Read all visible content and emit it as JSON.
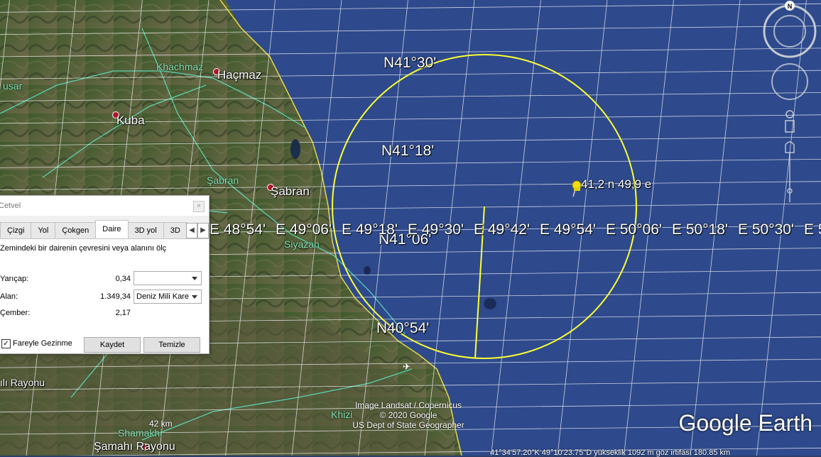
{
  "map": {
    "lat_labels": [
      "N41°30'",
      "N41°18'",
      "N41°06'",
      "N40°54'"
    ],
    "lon_labels": [
      "E 48°54'",
      "E 49°06'",
      "E 49°18'",
      "E 49°30'",
      "E 49°42'",
      "E 49°54'",
      "E 50°06'",
      "E 50°18'",
      "E 50°30'",
      "E 5"
    ],
    "places": {
      "khachmaz": "Khachmaz",
      "hacmaz": "Haçmaz",
      "kusar": "usar",
      "kuba": "Kuba",
      "sabran_green": "Şabran",
      "sabran": "Şabran",
      "siyazan": "Siyazan",
      "rayonu": "ılı Rayonu",
      "khizi": "Khizi",
      "shamakhi": "Shamakhi",
      "samahi_rayonu": "Şamahı Rayonu"
    },
    "pin_label": "41,2 n 49,9 e",
    "scale_text": "42 km",
    "attribution": [
      "Image Landsat / Copernicus",
      "© 2020 Google",
      "US Dept of State Geographer"
    ],
    "logo": "Google Earth",
    "status_bar": "41°34'57.20\"K    49°10'23.75\"D    yükseklik   1092 m        göz irtifası  180.85 km",
    "compass_label": "N",
    "colors": {
      "water": "#2e4a8c",
      "circle": "#ffff33",
      "grid": "#ffffff",
      "road": "#5ee6c4",
      "border": "#e6d84a"
    }
  },
  "ruler": {
    "title": "Cetvel",
    "tabs": [
      "Çizgi",
      "Yol",
      "Çokgen",
      "Daire",
      "3D yol",
      "3D"
    ],
    "active_tab": "Daire",
    "description": "Zemindeki bir dairenin çevresini veya alanını ölç",
    "radius_label": "Yarıçap:",
    "radius_value": "0,34",
    "radius_unit": "",
    "area_label": "Alan:",
    "area_value": "1.349,34",
    "area_unit": "Deniz Mili Kare",
    "circumference_label": "Çember:",
    "circumference_value": "2,17",
    "mouse_nav_label": "Fareyle Gezinme",
    "mouse_nav_checked": "✓",
    "save_label": "Kaydet",
    "clear_label": "Temizle"
  }
}
